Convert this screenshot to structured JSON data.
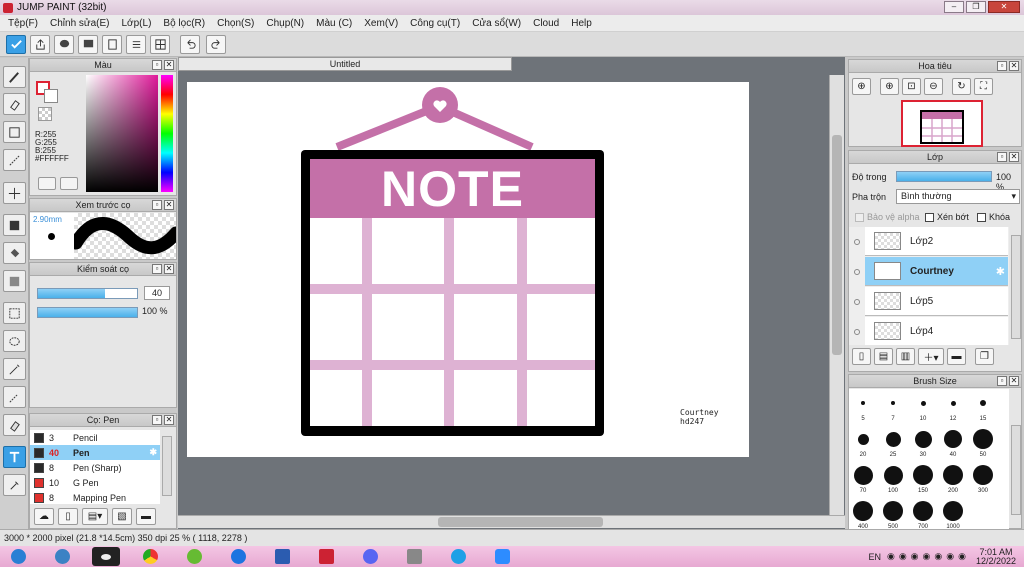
{
  "window": {
    "title": "JUMP PAINT (32bit)"
  },
  "menu": [
    "Tệp(F)",
    "Chỉnh sửa(E)",
    "Lớp(L)",
    "Bộ lọc(R)",
    "Chọn(S)",
    "Chụp(N)",
    "Màu (C)",
    "Xem(V)",
    "Công cụ(T)",
    "Cửa sổ(W)",
    "Cloud",
    "Help"
  ],
  "document": {
    "tab": "Untitled",
    "note_title": "NOTE",
    "signature_line1": "Courtney",
    "signature_line2": "hd247"
  },
  "color_panel": {
    "title": "Màu",
    "r": "R:255",
    "g": "G:255",
    "b": "B:255",
    "hex": "#FFFFFF"
  },
  "preview_panel": {
    "title": "Xem trước cọ",
    "size": "2.90mm"
  },
  "control_panel": {
    "title": "Kiểm soát cọ",
    "size_value": "40",
    "size_fraction": 0.68,
    "opacity_value": "100 %",
    "opacity_fraction": 1.0
  },
  "brush_list": {
    "title": "Cọ: Pen",
    "items": [
      {
        "size": "3",
        "name": "Pencil",
        "color": "#2a2a2a",
        "selected": false
      },
      {
        "size": "40",
        "name": "Pen",
        "color": "#2a2a2a",
        "selected": true
      },
      {
        "size": "8",
        "name": "Pen (Sharp)",
        "color": "#2a2a2a",
        "selected": false
      },
      {
        "size": "10",
        "name": "G Pen",
        "color": "#e0322e",
        "selected": false
      },
      {
        "size": "8",
        "name": "Mapping Pen",
        "color": "#e0322e",
        "selected": false
      }
    ]
  },
  "navigator": {
    "title": "Hoa tiêu"
  },
  "layer_panel": {
    "title": "Lớp",
    "opacity_label": "Độ trong",
    "opacity_value": "100 %",
    "opacity_fraction": 1.0,
    "blend_label": "Pha trộn",
    "blend_value": "Bình thường",
    "protect_alpha": "Bảo vệ alpha",
    "clipping": "Xén bớt",
    "lock": "Khóa",
    "layers": [
      {
        "name": "Lớp2",
        "selected": false
      },
      {
        "name": "Courtney",
        "selected": true
      },
      {
        "name": "Lớp5",
        "selected": false
      },
      {
        "name": "Lớp4",
        "selected": false
      }
    ]
  },
  "brush_size_panel": {
    "title": "Brush Size",
    "sizes": [
      "5",
      "7",
      "10",
      "12",
      "15",
      "20",
      "25",
      "30",
      "40",
      "50",
      "70",
      "100",
      "150",
      "200",
      "300",
      "400",
      "500",
      "700",
      "1000"
    ]
  },
  "status": {
    "text": "3000 * 2000 pixel  (21.8 *14.5cm)  350 dpi  25 %  ( 1118, 2278 )"
  },
  "taskbar": {
    "lang": "EN",
    "time": "7:01 AM",
    "date": "12/2/2022"
  },
  "colors": {
    "accent": "#3aa0e6",
    "note_pink": "#c470a8",
    "grid_pink": "#d9a5cc"
  }
}
